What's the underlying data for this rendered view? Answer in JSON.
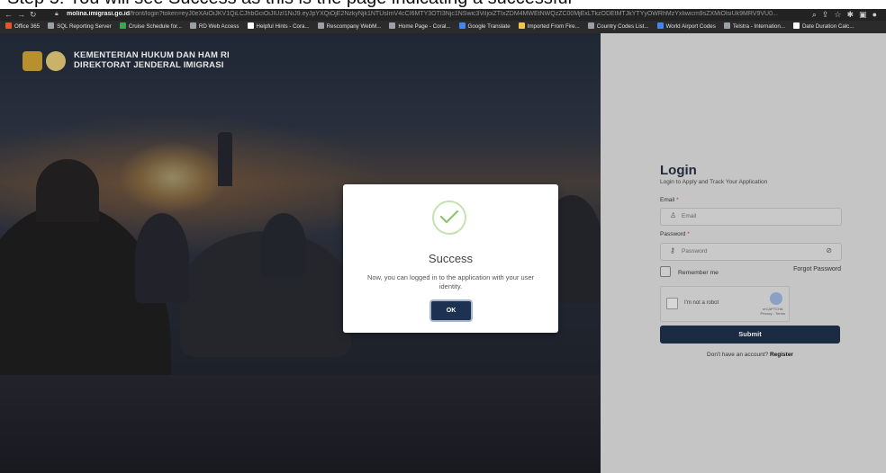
{
  "caption": "Step 5: You will see Success as this is the page indicating a successful",
  "browser": {
    "url_domain": "molina.imigrasi.go.id",
    "url_path": "/front/login?token=eyJ0eXAiOiJKV1QiLCJhbGciOiJIUzI1NiJ9.eyJpYXQiOjE2NzkyNjk1NTUsImV4cCI6MTY3OTI3Njc1NSwic3ViIjoiZTIxZDM4MWEtNWQzZC00MjExLTkzODEtMTJkYTYyOWRhMzYxIiwicm9sZXMiOlsiUk9MRV9VU0..."
  },
  "bookmarks": [
    {
      "label": "Office 365",
      "color": "#e8532b"
    },
    {
      "label": "SQL Reporting Server",
      "color": "#9aa0a6"
    },
    {
      "label": "Cruise Schedule for...",
      "color": "#3aa757"
    },
    {
      "label": "RD Web Access",
      "color": "#9aa0a6"
    },
    {
      "label": "Helpful Hints - Cora...",
      "color": "#ffffff"
    },
    {
      "label": "Rescompany WebM...",
      "color": "#9aa0a6"
    },
    {
      "label": "Home Page - Coral...",
      "color": "#9aa0a6"
    },
    {
      "label": "Google Translate",
      "color": "#4285f4"
    },
    {
      "label": "Imported From Fire...",
      "color": "#f4c542"
    },
    {
      "label": "Country Codes List...",
      "color": "#9aa0a6"
    },
    {
      "label": "World Airport Codes",
      "color": "#4285f4"
    },
    {
      "label": "Telstra - Internation...",
      "color": "#9aa0a6"
    },
    {
      "label": "Date Duration Calc...",
      "color": "#ffffff"
    }
  ],
  "org": {
    "line1": "KEMENTERIAN HUKUM DAN HAM RI",
    "line2": "DIREKTORAT JENDERAL IMIGRASI"
  },
  "login": {
    "title": "Login",
    "subtitle": "Login to Apply and Track Your Application",
    "email_label": "Email",
    "email_placeholder": "Email",
    "password_label": "Password",
    "password_placeholder": "Password",
    "remember": "Remember me",
    "forgot": "Forgot Password",
    "captcha_text": "I'm not a robot",
    "captcha_brand": "reCAPTCHA",
    "captcha_links": "Privacy - Terms",
    "submit": "Submit",
    "no_account": "Don't have an account?",
    "register": "Register"
  },
  "modal": {
    "title": "Success",
    "message": "Now, you can logged in to the application with your user identity.",
    "ok": "OK"
  }
}
